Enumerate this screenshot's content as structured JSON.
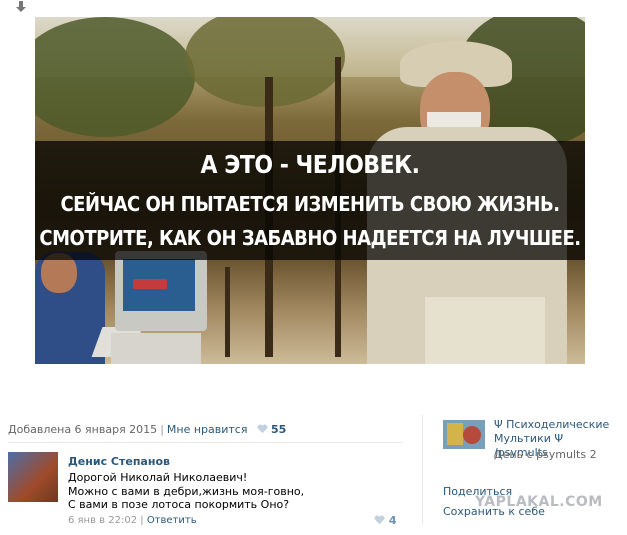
{
  "image": {
    "caption_line1": "А ЭТО - ЧЕЛОВЕК.",
    "caption_line2": "СЕЙЧАС ОН ПЫТАЕТСЯ ИЗМЕНИТЬ СВОЮ ЖИЗНЬ.",
    "caption_line3": "СМОТРИТЕ, КАК ОН ЗАБАВНО НАДЕЕТСЯ НА ЛУЧШЕЕ."
  },
  "post": {
    "date": "Добавлена 6 января 2015",
    "separator": "|",
    "like_label": "Мне нравится",
    "like_count": "55"
  },
  "comment": {
    "author": "Денис Степанов",
    "lines": [
      "Дорогой Николай Николаевич!",
      "Можно с вами в дебри,жизнь моя-говно,",
      "С вами в позе лотоса покормить Оно?"
    ],
    "time": "6 янв в 22:02",
    "separator": "|",
    "reply": "Ответить",
    "likes": "4"
  },
  "group": {
    "name": "Ψ Психоделические Мультики Ψ /psymults",
    "day": "День с psymults 2"
  },
  "actions": {
    "share": "Поделиться",
    "save": "Сохранить к себе"
  },
  "watermark": "YAPLAKAL.COM",
  "colors": {
    "link": "#2b587a",
    "muted": "#666666",
    "heart": "#c3d0df"
  }
}
